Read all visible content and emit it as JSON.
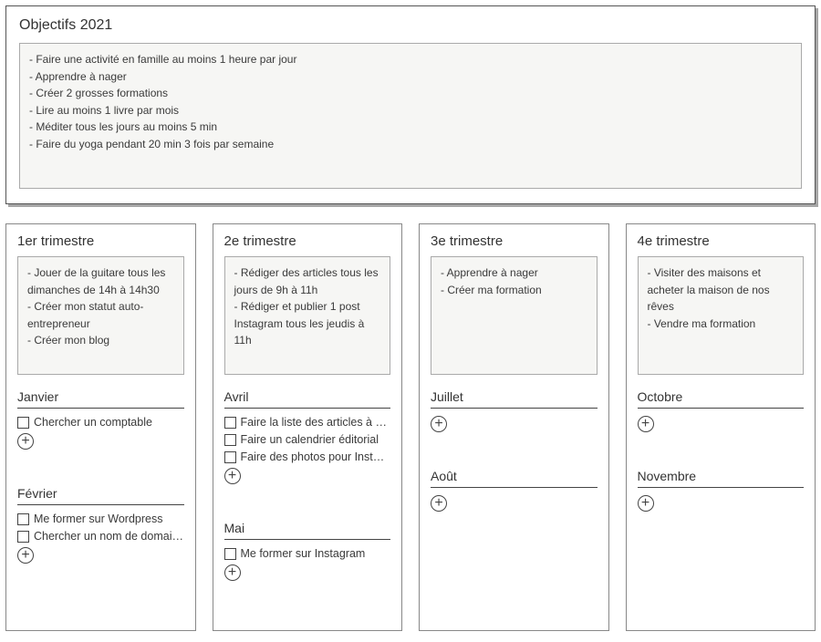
{
  "main": {
    "title": "Objectifs 2021",
    "goals": [
      "- Faire une activité en famille au moins 1 heure par jour",
      "- Apprendre à nager",
      "- Créer 2 grosses formations",
      "- Lire au moins 1 livre par mois",
      "- Méditer tous les jours au moins 5 min",
      "- Faire du yoga pendant 20 min 3 fois par semaine"
    ]
  },
  "quarters": [
    {
      "title": "1er trimestre",
      "goals": [
        "- Jouer de la guitare tous les dimanches de 14h à 14h30",
        "- Créer mon statut auto-entrepreneur",
        "- Créer mon blog"
      ],
      "months": [
        {
          "name": "Janvier",
          "tasks": [
            "Chercher un comptable"
          ]
        },
        {
          "name": "Février",
          "tasks": [
            "Me former sur Wordpress",
            "Chercher un nom de domaine"
          ]
        }
      ]
    },
    {
      "title": "2e trimestre",
      "goals": [
        "- Rédiger des articles tous les jours de 9h à 11h",
        "- Rédiger et publier 1 post Instagram tous les jeudis à 11h"
      ],
      "months": [
        {
          "name": "Avril",
          "tasks": [
            "Faire la liste des articles à rédiger",
            "Faire un calendrier éditorial",
            "Faire des photos pour Instagram"
          ]
        },
        {
          "name": "Mai",
          "tasks": [
            "Me former sur Instagram"
          ]
        }
      ]
    },
    {
      "title": "3e trimestre",
      "goals": [
        "- Apprendre à nager",
        "- Créer ma formation"
      ],
      "months": [
        {
          "name": "Juillet",
          "tasks": []
        },
        {
          "name": "Août",
          "tasks": []
        }
      ]
    },
    {
      "title": "4e trimestre",
      "goals": [
        "- Visiter des maisons et acheter la maison de nos rêves",
        "- Vendre ma formation"
      ],
      "months": [
        {
          "name": "Octobre",
          "tasks": []
        },
        {
          "name": "Novembre",
          "tasks": []
        }
      ]
    }
  ]
}
